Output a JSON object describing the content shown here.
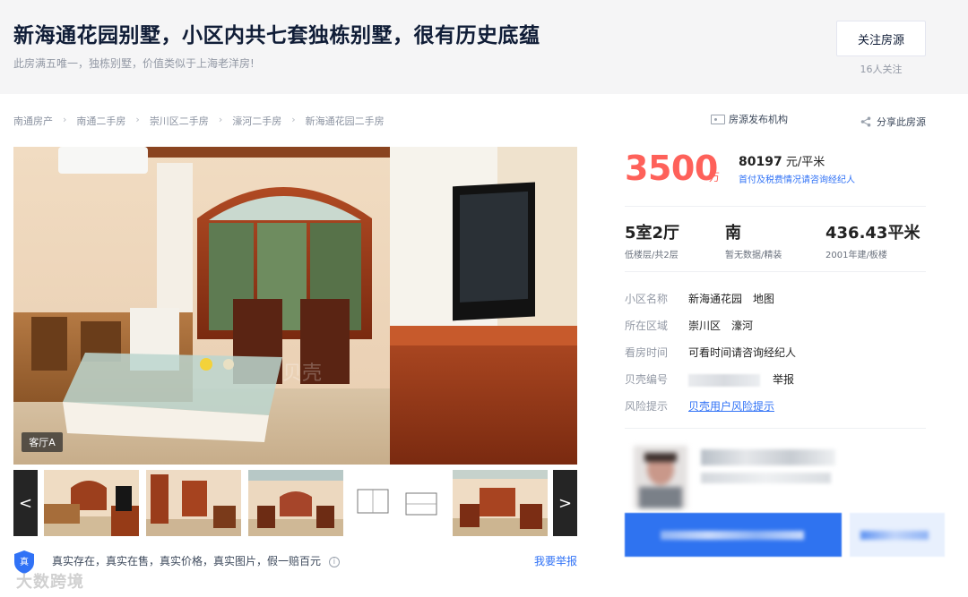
{
  "header": {
    "title": "新海通花园别墅，小区内共七套独栋别墅，很有历史底蕴",
    "subtitle": "此房满五唯一，独栋别墅，价值类似于上海老洋房!",
    "follow_button": "关注房源",
    "follow_count": "16人关注"
  },
  "breadcrumbs": [
    "南通房产",
    "南通二手房",
    "崇川区二手房",
    "濠河二手房",
    "新海通花园二手房"
  ],
  "agency_label": "房源发布机构",
  "share_label": "分享此房源",
  "gallery": {
    "room_label": "客厅A",
    "prev": "<",
    "next": ">",
    "thumb_icons": [
      "living-room-thumb",
      "room-thumb",
      "dining-room-thumb",
      "floorplan-thumb",
      "living-room-thumb-2"
    ]
  },
  "guarantee": {
    "shield_text": "真",
    "text": "真实存在，真实在售，真实价格，真实图片，假一赔百元",
    "info": "i",
    "report": "我要举报"
  },
  "watermark": "大数跨境",
  "price": {
    "total": "3500",
    "total_unit": "万",
    "unit_price": "80197",
    "unit_price_suffix": " 元/平米",
    "tax_link": "首付及税费情况请咨询经纪人"
  },
  "facts": [
    {
      "main": "5室2厅",
      "sub": "低楼层/共2层"
    },
    {
      "main": "南",
      "sub": "暂无数据/精装"
    },
    {
      "main": "436.43平米",
      "sub": "2001年建/板楼"
    }
  ],
  "info": {
    "community_key": "小区名称",
    "community_value": "新海通花园",
    "map_link": "地图",
    "area_key": "所在区域",
    "area_value_1": "崇川区",
    "area_value_2": "濠河",
    "visit_key": "看房时间",
    "visit_value": "可看时间请咨询经纪人",
    "code_key": "贝壳编号",
    "code_report": "举报",
    "risk_key": "风险提示",
    "risk_value": "贝壳用户风险提示"
  },
  "colors": {
    "price_red": "#fe615a",
    "link_blue": "#3072f6",
    "title_navy": "#101d37",
    "header_bg": "#f5f5f6"
  }
}
